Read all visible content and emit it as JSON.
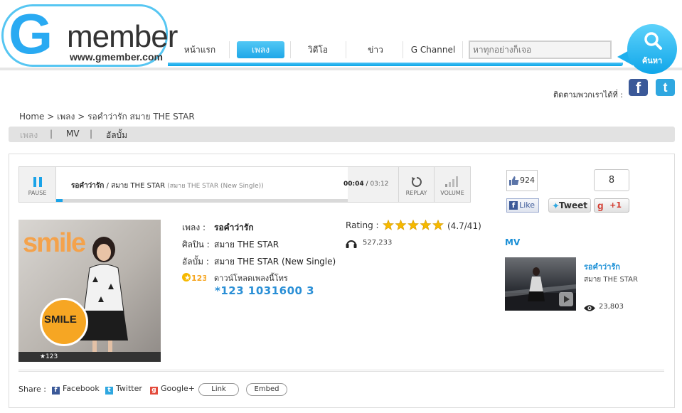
{
  "header": {
    "logo_g": "G",
    "logo_word": "member",
    "logo_url": "www.gmember.com",
    "nav": [
      "หน้าแรก",
      "เพลง",
      "วิดีโอ",
      "ข่าว",
      "G Channel"
    ],
    "active_nav": "เพลง",
    "search_placeholder": "หาทุกอย่างก็เจอ",
    "search_button_label": "ค้นหา"
  },
  "follow": {
    "label": "ติดตามพวกเราได้ที่ :"
  },
  "breadcrumb": {
    "home": "Home",
    "sep1": ">",
    "section": "เพลง",
    "sep2": ">",
    "current": "รอคำว่ารัก สมาย THE STAR"
  },
  "subtabs": {
    "song": "เพลง",
    "mv": "MV",
    "album": "อัลบั้ม",
    "sep": "|"
  },
  "player": {
    "pause_label": "PAUSE",
    "track_title": "รอคำว่ารัก",
    "track_sep": "/",
    "track_artist": "สมาย THE STAR",
    "track_sub": "(สมาย THE STAR (New Single))",
    "time_current": "00:04",
    "time_sep": "/",
    "time_total": "03:12",
    "progress_fraction": 0.021,
    "replay_label": "REPLAY",
    "volume_label": "VOLUME"
  },
  "social": {
    "like_count": "924",
    "like_label": "Like",
    "tweet_label": "Tweet",
    "gplus_count": "8",
    "gplus_label": "+1"
  },
  "album_art": {
    "smile_top": "smile",
    "badge_text": "SMILE",
    "footer": "★123"
  },
  "song": {
    "title_label": "เพลง :",
    "title": "รอคำว่ารัก",
    "artist_label": "ศิลปิน :",
    "artist": "สมาย THE STAR",
    "album_label": "อัลบั้ม :",
    "album": "สมาย THE STAR (New Single)",
    "code_logo": "123",
    "download_label": "ดาวน์โหลดเพลงนี้โทร",
    "download_code": "*123 1031600 3"
  },
  "rating": {
    "label": "Rating :",
    "value": "(4.7/41)",
    "stars_filled": 5,
    "plays": "527,233"
  },
  "mv": {
    "heading": "MV",
    "title": "รอคำว่ารัก",
    "artist": "สมาย THE STAR",
    "views": "23,803"
  },
  "share": {
    "label": "Share :",
    "facebook": "Facebook",
    "twitter": "Twitter",
    "googleplus": "Google+",
    "link": "Link",
    "embed": "Embed"
  },
  "colors": {
    "accent": "#1aa3e8",
    "brand_blue": "#29aaf2",
    "facebook": "#3b5998",
    "twitter": "#2fa7e0",
    "star": "#f6b900",
    "mv_link": "#1a8fd6"
  }
}
